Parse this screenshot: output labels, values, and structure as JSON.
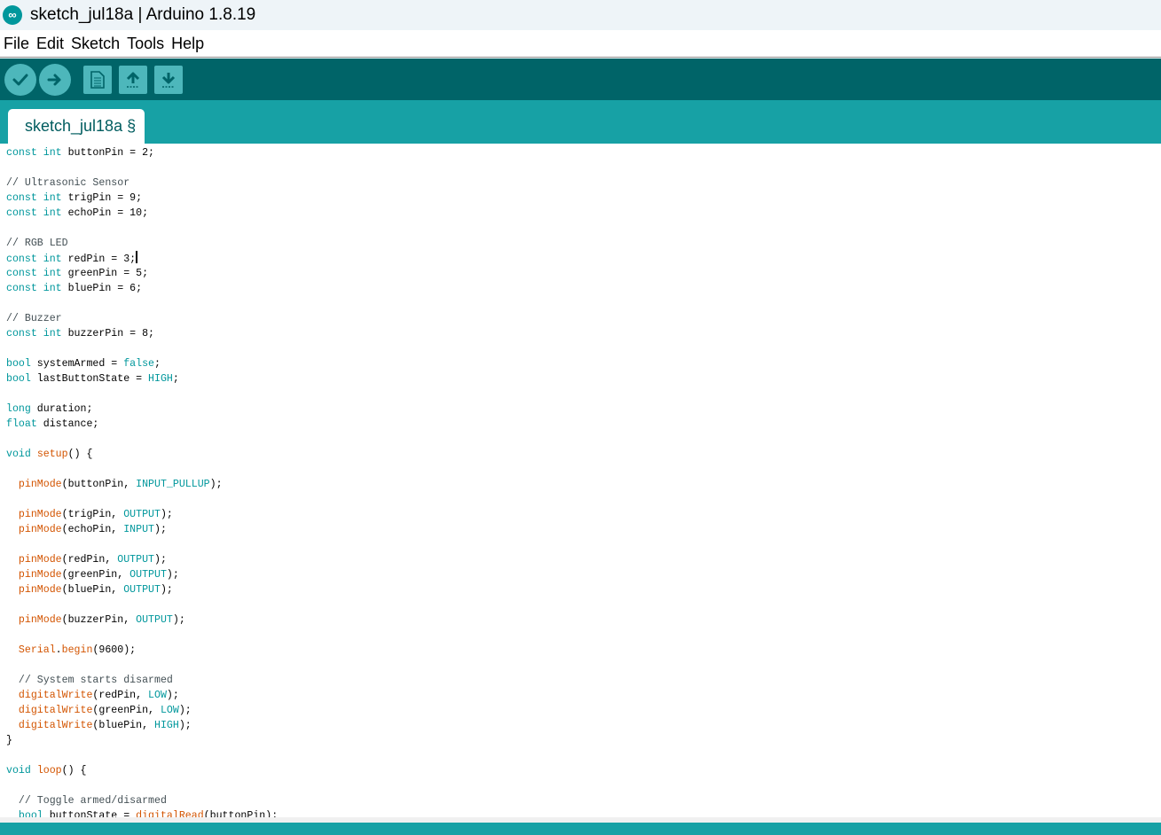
{
  "window": {
    "title": "sketch_jul18a | Arduino 1.8.19",
    "logo_glyph": "∞",
    "logo_icon": "arduino-logo-icon"
  },
  "menu": {
    "items": [
      "File",
      "Edit",
      "Sketch",
      "Tools",
      "Help"
    ]
  },
  "toolbar": {
    "buttons": [
      {
        "name": "verify",
        "icon": "checkmark-icon"
      },
      {
        "name": "upload",
        "icon": "arrow-right-icon"
      },
      {
        "name": "new",
        "icon": "new-document-icon"
      },
      {
        "name": "open",
        "icon": "arrow-up-icon"
      },
      {
        "name": "save",
        "icon": "arrow-down-icon"
      }
    ]
  },
  "tabs": [
    {
      "label": "sketch_jul18a §",
      "active": true
    }
  ],
  "colors": {
    "toolbar": "#006468",
    "tabstrip": "#17a1a5",
    "keyword": "#00979c",
    "function": "#d35400",
    "comment": "#434f54"
  },
  "code": {
    "cursor_line": 8,
    "lines": [
      [
        [
          "kw",
          "const"
        ],
        [
          "t",
          " "
        ],
        [
          "kw",
          "int"
        ],
        [
          "t",
          " buttonPin = 2;"
        ]
      ],
      [],
      [
        [
          "cm",
          "// Ultrasonic Sensor"
        ]
      ],
      [
        [
          "kw",
          "const"
        ],
        [
          "t",
          " "
        ],
        [
          "kw",
          "int"
        ],
        [
          "t",
          " trigPin = 9;"
        ]
      ],
      [
        [
          "kw",
          "const"
        ],
        [
          "t",
          " "
        ],
        [
          "kw",
          "int"
        ],
        [
          "t",
          " echoPin = 10;"
        ]
      ],
      [],
      [
        [
          "cm",
          "// RGB LED"
        ]
      ],
      [
        [
          "kw",
          "const"
        ],
        [
          "t",
          " "
        ],
        [
          "kw",
          "int"
        ],
        [
          "t",
          " redPin = 3;"
        ]
      ],
      [
        [
          "kw",
          "const"
        ],
        [
          "t",
          " "
        ],
        [
          "kw",
          "int"
        ],
        [
          "t",
          " greenPin = 5;"
        ]
      ],
      [
        [
          "kw",
          "const"
        ],
        [
          "t",
          " "
        ],
        [
          "kw",
          "int"
        ],
        [
          "t",
          " bluePin = 6;"
        ]
      ],
      [],
      [
        [
          "cm",
          "// Buzzer"
        ]
      ],
      [
        [
          "kw",
          "const"
        ],
        [
          "t",
          " "
        ],
        [
          "kw",
          "int"
        ],
        [
          "t",
          " buzzerPin = 8;"
        ]
      ],
      [],
      [
        [
          "kw",
          "bool"
        ],
        [
          "t",
          " systemArmed = "
        ],
        [
          "kw",
          "false"
        ],
        [
          "t",
          ";"
        ]
      ],
      [
        [
          "kw",
          "bool"
        ],
        [
          "t",
          " lastButtonState = "
        ],
        [
          "kw",
          "HIGH"
        ],
        [
          "t",
          ";"
        ]
      ],
      [],
      [
        [
          "kw",
          "long"
        ],
        [
          "t",
          " duration;"
        ]
      ],
      [
        [
          "kw",
          "float"
        ],
        [
          "t",
          " distance;"
        ]
      ],
      [],
      [
        [
          "kw",
          "void"
        ],
        [
          "t",
          " "
        ],
        [
          "fn",
          "setup"
        ],
        [
          "t",
          "() {"
        ]
      ],
      [],
      [
        [
          "t",
          "  "
        ],
        [
          "fn",
          "pinMode"
        ],
        [
          "t",
          "(buttonPin, "
        ],
        [
          "kw",
          "INPUT_PULLUP"
        ],
        [
          "t",
          ");"
        ]
      ],
      [],
      [
        [
          "t",
          "  "
        ],
        [
          "fn",
          "pinMode"
        ],
        [
          "t",
          "(trigPin, "
        ],
        [
          "kw",
          "OUTPUT"
        ],
        [
          "t",
          ");"
        ]
      ],
      [
        [
          "t",
          "  "
        ],
        [
          "fn",
          "pinMode"
        ],
        [
          "t",
          "(echoPin, "
        ],
        [
          "kw",
          "INPUT"
        ],
        [
          "t",
          ");"
        ]
      ],
      [],
      [
        [
          "t",
          "  "
        ],
        [
          "fn",
          "pinMode"
        ],
        [
          "t",
          "(redPin, "
        ],
        [
          "kw",
          "OUTPUT"
        ],
        [
          "t",
          ");"
        ]
      ],
      [
        [
          "t",
          "  "
        ],
        [
          "fn",
          "pinMode"
        ],
        [
          "t",
          "(greenPin, "
        ],
        [
          "kw",
          "OUTPUT"
        ],
        [
          "t",
          ");"
        ]
      ],
      [
        [
          "t",
          "  "
        ],
        [
          "fn",
          "pinMode"
        ],
        [
          "t",
          "(bluePin, "
        ],
        [
          "kw",
          "OUTPUT"
        ],
        [
          "t",
          ");"
        ]
      ],
      [],
      [
        [
          "t",
          "  "
        ],
        [
          "fn",
          "pinMode"
        ],
        [
          "t",
          "(buzzerPin, "
        ],
        [
          "kw",
          "OUTPUT"
        ],
        [
          "t",
          ");"
        ]
      ],
      [],
      [
        [
          "t",
          "  "
        ],
        [
          "fn",
          "Serial"
        ],
        [
          "t",
          "."
        ],
        [
          "fn",
          "begin"
        ],
        [
          "t",
          "(9600);"
        ]
      ],
      [],
      [
        [
          "t",
          "  "
        ],
        [
          "cm",
          "// System starts disarmed"
        ]
      ],
      [
        [
          "t",
          "  "
        ],
        [
          "fn",
          "digitalWrite"
        ],
        [
          "t",
          "(redPin, "
        ],
        [
          "kw",
          "LOW"
        ],
        [
          "t",
          ");"
        ]
      ],
      [
        [
          "t",
          "  "
        ],
        [
          "fn",
          "digitalWrite"
        ],
        [
          "t",
          "(greenPin, "
        ],
        [
          "kw",
          "LOW"
        ],
        [
          "t",
          ");"
        ]
      ],
      [
        [
          "t",
          "  "
        ],
        [
          "fn",
          "digitalWrite"
        ],
        [
          "t",
          "(bluePin, "
        ],
        [
          "kw",
          "HIGH"
        ],
        [
          "t",
          ");"
        ]
      ],
      [
        [
          "t",
          "}"
        ]
      ],
      [],
      [
        [
          "kw",
          "void"
        ],
        [
          "t",
          " "
        ],
        [
          "fn",
          "loop"
        ],
        [
          "t",
          "() {"
        ]
      ],
      [],
      [
        [
          "t",
          "  "
        ],
        [
          "cm",
          "// Toggle armed/disarmed"
        ]
      ],
      [
        [
          "t",
          "  "
        ],
        [
          "kw",
          "bool"
        ],
        [
          "t",
          " buttonState = "
        ],
        [
          "fn",
          "digitalRead"
        ],
        [
          "t",
          "(buttonPin);"
        ]
      ]
    ]
  }
}
